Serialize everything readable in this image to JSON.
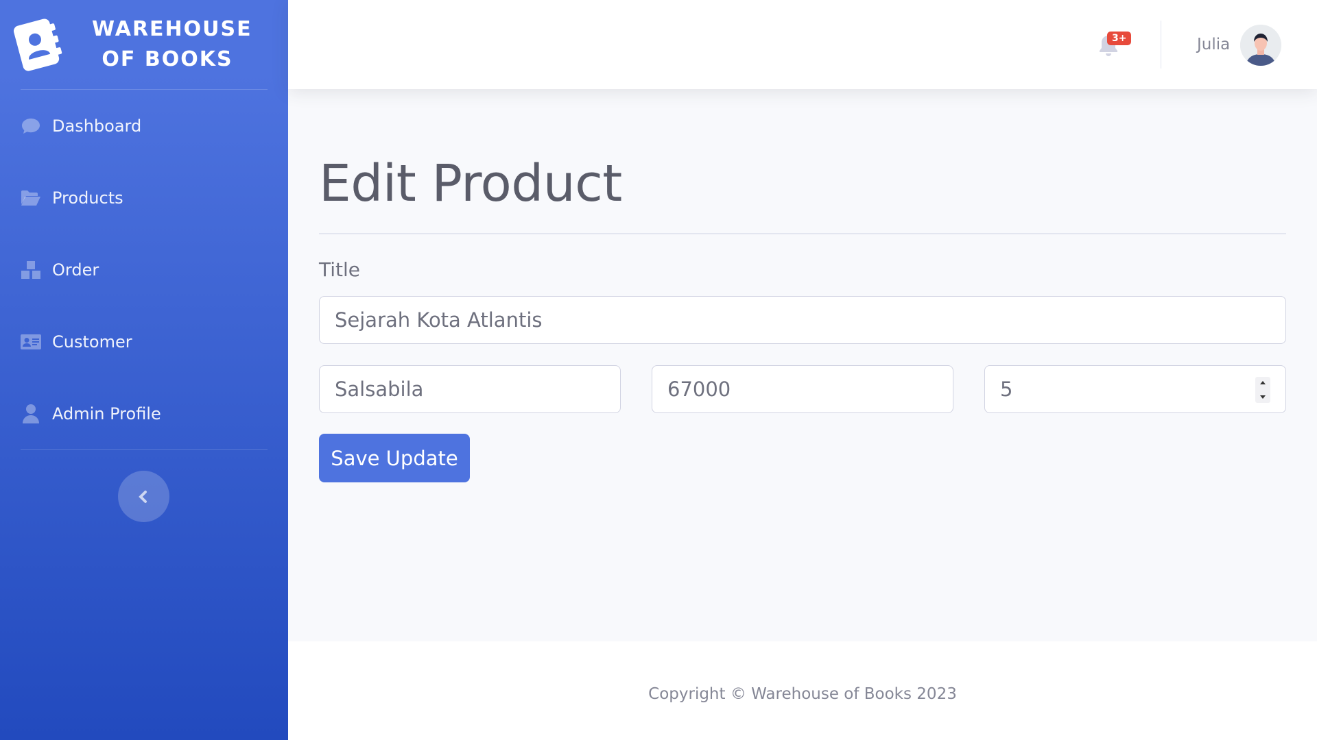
{
  "brand": {
    "line1": "WAREHOUSE",
    "line2": "OF BOOKS",
    "logo_icon": "address-book-icon"
  },
  "sidebar": {
    "items": [
      {
        "label": "Dashboard",
        "icon": "comment-icon"
      },
      {
        "label": "Products",
        "icon": "folder-open-icon"
      },
      {
        "label": "Order",
        "icon": "boxes-icon"
      },
      {
        "label": "Customer",
        "icon": "id-card-icon"
      },
      {
        "label": "Admin Profile",
        "icon": "user-icon"
      }
    ],
    "toggle_icon": "chevron-left-icon"
  },
  "topbar": {
    "notifications_badge": "3+",
    "username": "Julia"
  },
  "main": {
    "page_title": "Edit Product",
    "title_label": "Title",
    "fields": {
      "title": "Sejarah Kota Atlantis",
      "author": "Salsabila",
      "price": "67000",
      "stock": "5"
    },
    "save_label": "Save Update"
  },
  "footer": {
    "copyright": "Copyright © Warehouse of Books 2023"
  },
  "colors": {
    "primary": "#4e73df",
    "primary_dark": "#224abe",
    "danger": "#e74a3b",
    "text": "#858796"
  }
}
